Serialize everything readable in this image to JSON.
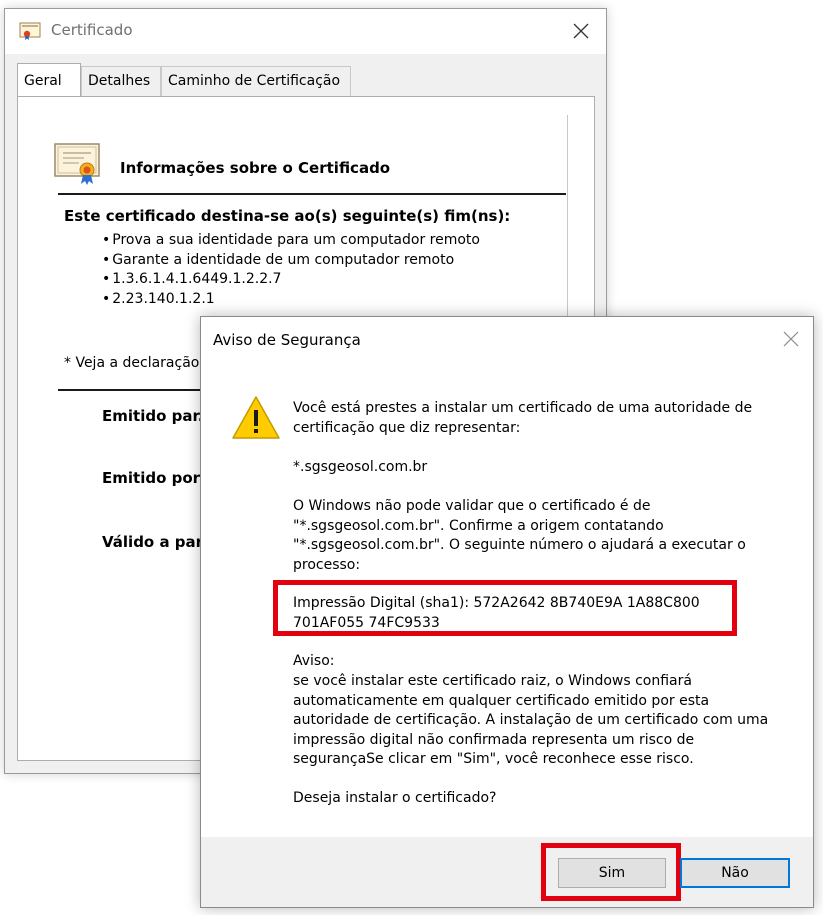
{
  "certificate_window": {
    "title": "Certificado",
    "tabs": [
      {
        "label": "Geral",
        "active": true
      },
      {
        "label": "Detalhes",
        "active": false
      },
      {
        "label": "Caminho de Certificação",
        "active": false
      }
    ],
    "info_title": "Informações sobre o Certificado",
    "purpose_heading": "Este certificado destina-se ao(s) seguinte(s) fim(ns):",
    "purposes": [
      "Prova a sua identidade para um computador remoto",
      "Garante a identidade de um computador remoto",
      "1.3.6.1.4.1.6449.1.2.2.7",
      "2.23.140.1.2.1"
    ],
    "declaration_note": "* Veja a declaração",
    "issued_to_label": "Emitido par.*",
    "issued_by_label": "Emitido por:S",
    "valid_from_label": "Válido a part"
  },
  "security_dialog": {
    "title": "Aviso de Segurança",
    "intro": "Você está prestes a instalar um certificado de uma autoridade de certificação que diz representar:",
    "domain": "*.sgsgeosol.com.br",
    "windows_message": "O Windows não pode validar que o certificado é de \"*.sgsgeosol.com.br\". Confirme a origem contatando \"*.sgsgeosol.com.br\". O seguinte número o ajudará a executar o processo:",
    "thumbprint": "Impressão Digital (sha1): 572A2642 8B740E9A 1A88C800 701AF055 74FC9533",
    "warning_label": "Aviso:",
    "warning_text": "se você instalar este certificado raiz, o Windows confiará automaticamente em qualquer certificado emitido por esta autoridade de certificação. A instalação de um certificado com uma impressão digital não confirmada representa um risco de segurançaSe clicar em \"Sim\", você reconhece esse risco.",
    "question": "Deseja instalar o certificado?",
    "yes_label": "Sim",
    "no_label": "Não"
  },
  "colors": {
    "highlight_red": "#e3000f",
    "focus_blue": "#0078d7",
    "warning_yellow": "#ffcc00"
  }
}
